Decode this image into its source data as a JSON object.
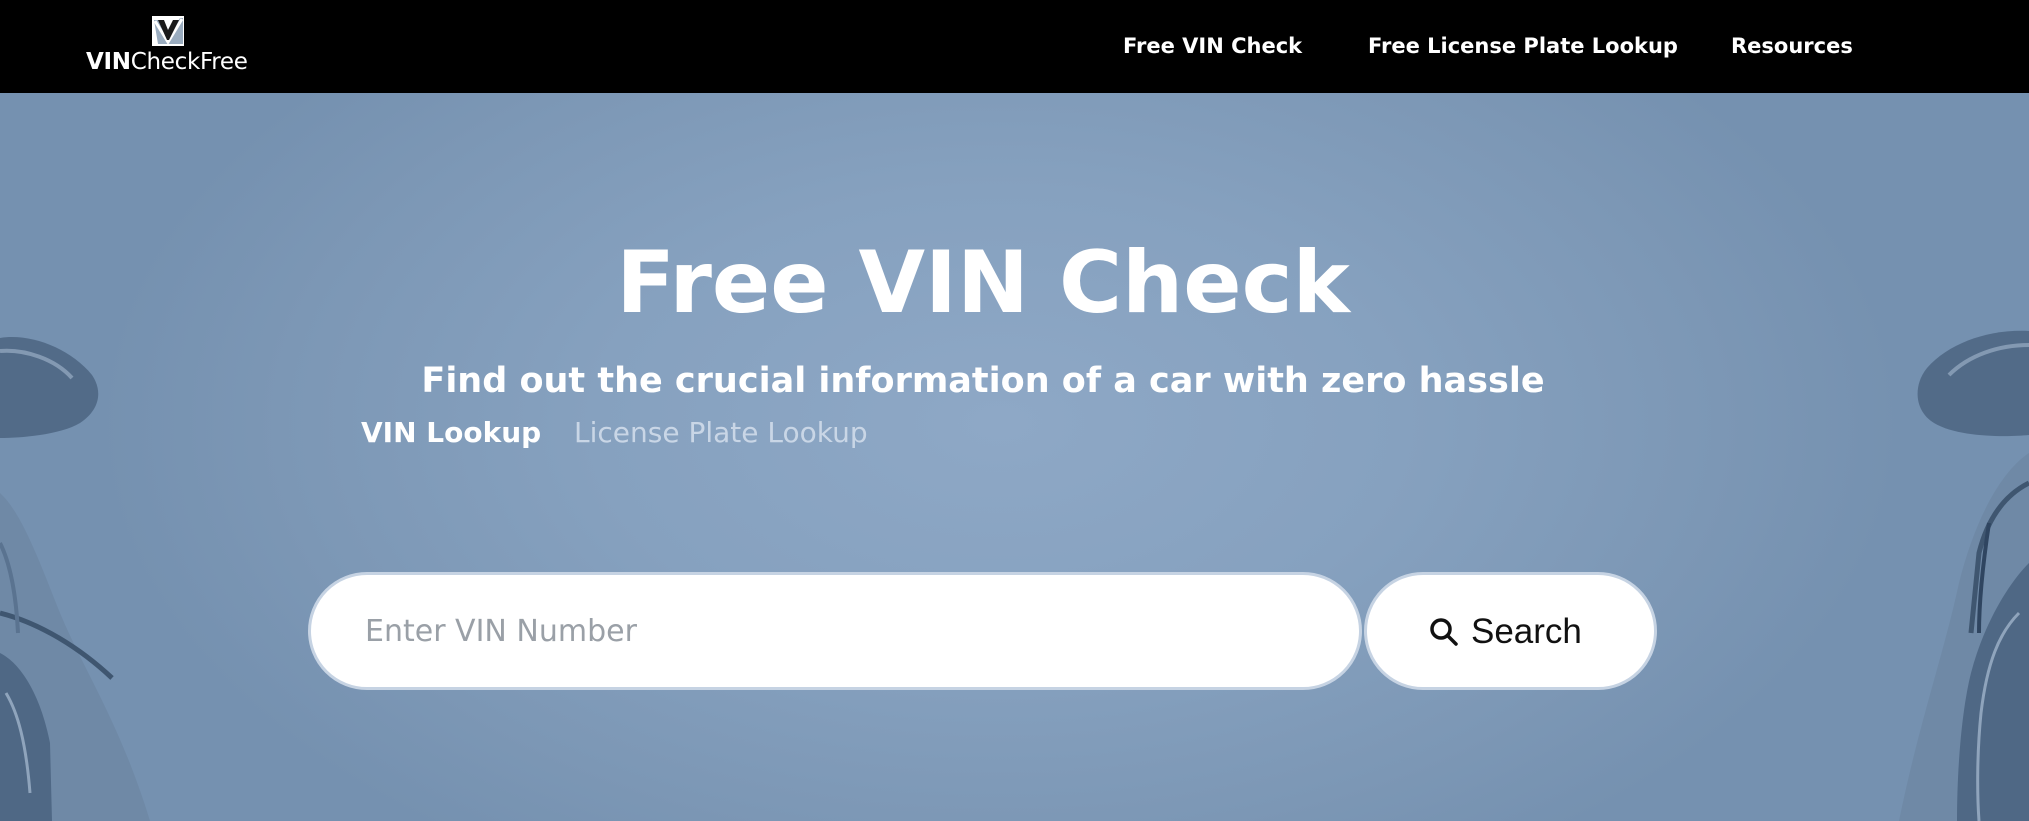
{
  "brand": {
    "logo_bold": "VIN",
    "logo_light": "CheckFree"
  },
  "nav": {
    "items": [
      {
        "label": "Free VIN Check"
      },
      {
        "label": "Free License Plate Lookup"
      },
      {
        "label": "Resources"
      }
    ]
  },
  "hero": {
    "title": "Free VIN Check",
    "subtitle": "Find out the crucial information of a car with zero hassle"
  },
  "search": {
    "tabs": [
      {
        "label": "VIN Lookup",
        "active": true
      },
      {
        "label": "License Plate Lookup",
        "active": false
      }
    ],
    "placeholder": "Enter VIN Number",
    "value": "",
    "button_label": "Search",
    "button_icon": "search-icon"
  },
  "colors": {
    "nav_background": "#000000",
    "hero_background": "#86a1bf",
    "text_primary": "#ffffff",
    "inactive_tab": "#c9d6e6",
    "input_border": "#c6d3e3"
  }
}
